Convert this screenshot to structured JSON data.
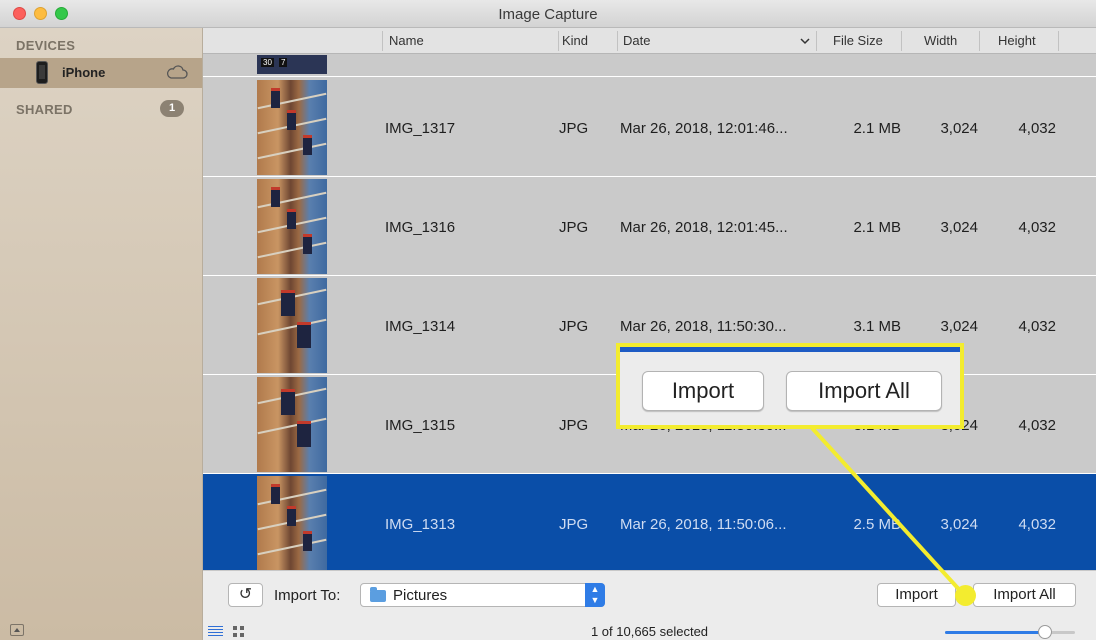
{
  "window": {
    "title": "Image Capture"
  },
  "sidebar": {
    "devices_header": "DEVICES",
    "device": {
      "name": "iPhone",
      "icon": "phone-icon",
      "status_icon": "cloud-eject-icon"
    },
    "shared_header": "SHARED",
    "shared_count": "1"
  },
  "table": {
    "columns": {
      "name": "Name",
      "kind": "Kind",
      "date": "Date",
      "size": "File Size",
      "width": "Width",
      "height": "Height"
    },
    "partial_thumb_labels": [
      "30",
      "7"
    ],
    "rows": [
      {
        "name": "IMG_1317",
        "kind": "JPG",
        "date": "Mar 26, 2018, 12:01:46...",
        "size": "2.1 MB",
        "width": "3,024",
        "height": "4,032"
      },
      {
        "name": "IMG_1316",
        "kind": "JPG",
        "date": "Mar 26, 2018, 12:01:45...",
        "size": "2.1 MB",
        "width": "3,024",
        "height": "4,032"
      },
      {
        "name": "IMG_1314",
        "kind": "JPG",
        "date": "Mar 26, 2018, 11:50:30...",
        "size": "3.1 MB",
        "width": "3,024",
        "height": "4,032"
      },
      {
        "name": "IMG_1315",
        "kind": "JPG",
        "date": "Mar 26, 2018, 11:50:30...",
        "size": "3.1 MB",
        "width": "3,024",
        "height": "4,032"
      },
      {
        "name": "IMG_1313",
        "kind": "JPG",
        "date": "Mar 26, 2018, 11:50:06...",
        "size": "2.5 MB",
        "width": "3,024",
        "height": "4,032",
        "selected": true
      }
    ]
  },
  "callout": {
    "import_label": "Import",
    "import_all_label": "Import All",
    "highlight_color": "#f3ec2f"
  },
  "toolbar": {
    "rotate_icon": "rotate-left-icon",
    "import_to_label": "Import To:",
    "destination": "Pictures",
    "import_label": "Import",
    "import_all_label": "Import All",
    "status": "1 of 10,665 selected",
    "zoom_level": 0.77
  },
  "colors": {
    "selection": "#0a4ea8",
    "accent": "#2f7ce6"
  }
}
